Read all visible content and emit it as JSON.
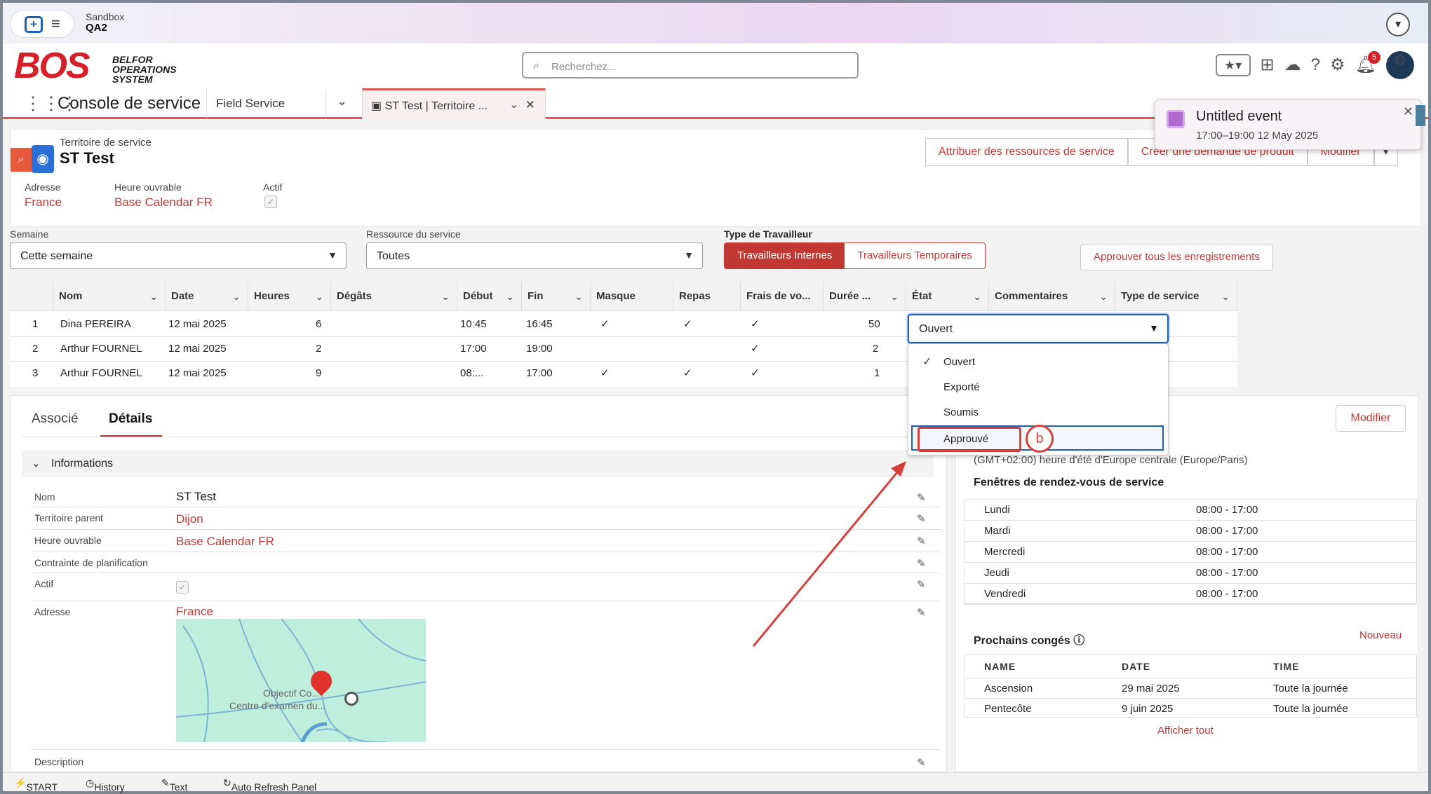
{
  "topbar": {
    "org_label": "Sandbox",
    "org_name": "QA2"
  },
  "header": {
    "logo_big": "BOS",
    "logo_small": "BELFOR OPERATIONS SYSTEM",
    "search_placeholder": "Recherchez...",
    "notification_count": "5"
  },
  "nav": {
    "app_name": "Console de service",
    "item": "Field Service",
    "workspace_tab": "ST Test | Territoire ..."
  },
  "record": {
    "type_label": "Territoire de service",
    "title": "ST Test",
    "fields": [
      {
        "label": "Adresse",
        "value": "France"
      },
      {
        "label": "Heure ouvrable",
        "value": "Base Calendar FR"
      },
      {
        "label": "Actif",
        "value": ""
      }
    ],
    "actions": [
      "Attribuer des ressources de service",
      "Créer une demande de produit",
      "Modifier"
    ]
  },
  "toast": {
    "title": "Untitled event",
    "detail": "17:00–19:00 12 May 2025"
  },
  "filters": {
    "week_label": "Semaine",
    "week_value": "Cette semaine",
    "resource_label": "Ressource du service",
    "resource_value": "Toutes",
    "worker_type_label": "Type de Travailleur",
    "worker_internal": "Travailleurs Internes",
    "worker_temp": "Travailleurs Temporaires",
    "approve_all": "Approuver tous les enregistrements"
  },
  "table": {
    "headers": [
      "Nom",
      "Date",
      "Heures",
      "Dégâts",
      "Début",
      "Fin",
      "Masque",
      "Repas",
      "Frais de vo...",
      "Durée ...",
      "État",
      "Commentaires",
      "Type de service"
    ],
    "rows": [
      {
        "num": "1",
        "nom": "Dina PEREIRA",
        "date": "12 mai 2025",
        "heures": "6",
        "debut": "10:45",
        "fin": "16:45",
        "masque": "✓",
        "repas": "✓",
        "frais": "✓",
        "duree": "50"
      },
      {
        "num": "2",
        "nom": "Arthur FOURNEL",
        "date": "12 mai 2025",
        "heures": "2",
        "debut": "17:00",
        "fin": "19:00",
        "masque": "",
        "repas": "",
        "frais": "✓",
        "duree": "2"
      },
      {
        "num": "3",
        "nom": "Arthur FOURNEL",
        "date": "12 mai 2025",
        "heures": "9",
        "debut": "08:...",
        "fin": "17:00",
        "masque": "✓",
        "repas": "✓",
        "frais": "✓",
        "duree": "1"
      }
    ]
  },
  "etat_dropdown": {
    "current": "Ouvert",
    "options": [
      "Ouvert",
      "Exporté",
      "Soumis",
      "Approuvé"
    ],
    "annotation": "b"
  },
  "details": {
    "tabs": [
      "Associé",
      "Détails"
    ],
    "section": "Informations",
    "fields": [
      {
        "label": "Nom",
        "value": "ST Test"
      },
      {
        "label": "Territoire parent",
        "value": "Dijon"
      },
      {
        "label": "Heure ouvrable",
        "value": "Base Calendar FR"
      },
      {
        "label": "Contrainte de planification",
        "value": ""
      },
      {
        "label": "Actif",
        "value": ""
      },
      {
        "label": "Adresse",
        "value": "France"
      },
      {
        "label": "Description",
        "value": ""
      }
    ],
    "map_label_1": "Objectif Co...",
    "map_label_2": "Centre d'examen du..."
  },
  "right_panel": {
    "edit": "Modifier",
    "timezone": "(GMT+02:00) heure d'été d'Europe centrale (Europe/Paris)",
    "windows_title": "Fenêtres de rendez-vous de service",
    "windows": [
      {
        "day": "Lundi",
        "hours": "08:00 - 17:00"
      },
      {
        "day": "Mardi",
        "hours": "08:00 - 17:00"
      },
      {
        "day": "Mercredi",
        "hours": "08:00 - 17:00"
      },
      {
        "day": "Jeudi",
        "hours": "08:00 - 17:00"
      },
      {
        "day": "Vendredi",
        "hours": "08:00 - 17:00"
      }
    ],
    "holidays_title": "Prochains congés",
    "new": "Nouveau",
    "holiday_headers": [
      "NAME",
      "DATE",
      "TIME"
    ],
    "holidays": [
      {
        "name": "Ascension",
        "date": "29 mai 2025",
        "time": "Toute la journée"
      },
      {
        "name": "Pentecôte",
        "date": "9 juin 2025",
        "time": "Toute la journée"
      }
    ],
    "show_all": "Afficher tout"
  },
  "utility_bar": [
    "START",
    "History",
    "Text",
    "Auto Refresh Panel"
  ]
}
